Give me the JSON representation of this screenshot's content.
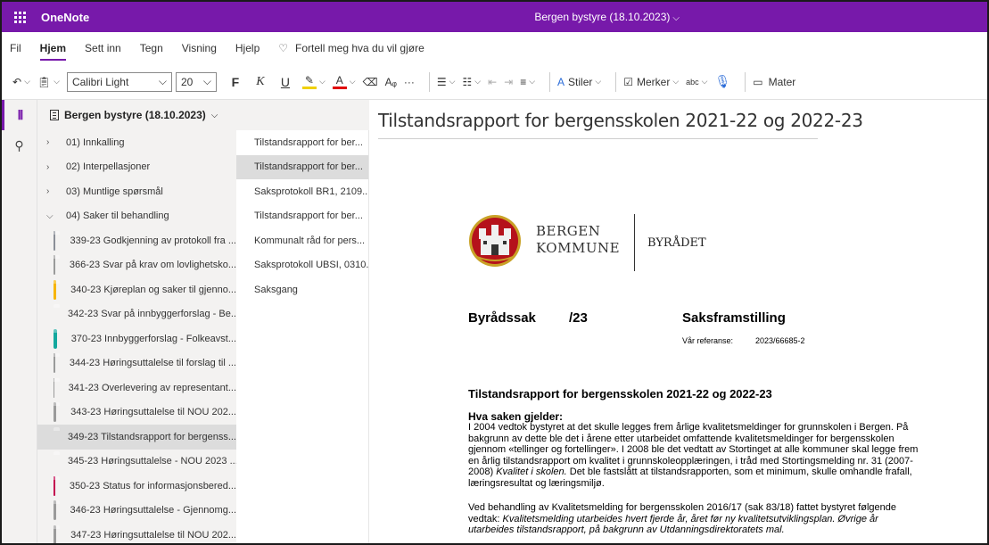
{
  "app": {
    "name": "OneNote",
    "doc_title": "Bergen bystyre (18.10.2023)"
  },
  "menu": {
    "items": [
      "Fil",
      "Hjem",
      "Sett inn",
      "Tegn",
      "Visning",
      "Hjelp"
    ],
    "active": "Hjem",
    "tell_me": "Fortell meg hva du vil gjøre"
  },
  "ribbon": {
    "font_name": "Calibri Light",
    "font_size": "20",
    "bold": "F",
    "italic": "K",
    "underline": "U",
    "color_letter": "A",
    "more": "···",
    "styles": "Stiler",
    "tags": "Merker",
    "spelling": "abc",
    "immersive": "Mater",
    "highlight_color": "#f0d000",
    "font_color": "#e00000"
  },
  "notebook": {
    "name": "Bergen bystyre (18.10.2023)"
  },
  "sections": [
    {
      "type": "group",
      "label": "01) Innkalling",
      "expanded": false
    },
    {
      "type": "group",
      "label": "02) Interpellasjoner",
      "expanded": false
    },
    {
      "type": "group",
      "label": "03) Muntlige spørsmål",
      "expanded": false
    },
    {
      "type": "group",
      "label": "04) Saker til behandling",
      "expanded": true
    },
    {
      "type": "child",
      "label": "339-23 Godkjenning av protokoll fra ...",
      "color": "#8a8f98"
    },
    {
      "type": "child",
      "label": "366-23 Svar på krav om lovlighetsko...",
      "color": "#9a9a9a"
    },
    {
      "type": "child",
      "label": "340-23 Kjøreplan og saker til gjenno...",
      "color": "#f7b500"
    },
    {
      "type": "child",
      "label": "342-23 Svar på innbyggerforslag - Be...",
      "color": "#f7b500"
    },
    {
      "type": "child",
      "label": "370-23 Innbyggerforslag - Folkeavst...",
      "color": "#13a89e"
    },
    {
      "type": "child",
      "label": "344-23 Høringsuttalelse til forslag til ...",
      "color": "#9a9a9a"
    },
    {
      "type": "child",
      "label": "341-23 Overlevering av representant...",
      "color": "#9a9a9a"
    },
    {
      "type": "child",
      "label": "343-23 Høringsuttalelse til NOU 202...",
      "color": "#9a9a9a"
    },
    {
      "type": "child",
      "label": "349-23 Tilstandsrapport for bergenss...",
      "color": "#1f5fa8",
      "selected": true
    },
    {
      "type": "child",
      "label": "345-23 Høringsuttalelse - NOU 2023 ...",
      "color": "#9a9a9a"
    },
    {
      "type": "child",
      "label": "350-23 Status for informasjonsbered...",
      "color": "#c3004e"
    },
    {
      "type": "child",
      "label": "346-23 Høringsuttalelse - Gjennomg...",
      "color": "#9a9a9a"
    },
    {
      "type": "child",
      "label": "347-23 Høringsuttalelse til NOU 202...",
      "color": "#9a9a9a"
    }
  ],
  "pages": [
    {
      "label": "Tilstandsrapport for ber...",
      "selected": false
    },
    {
      "label": "Tilstandsrapport for ber...",
      "selected": true
    },
    {
      "label": "Saksprotokoll BR1, 2109...",
      "selected": false
    },
    {
      "label": "Tilstandsrapport for ber...",
      "selected": false
    },
    {
      "label": "Kommunalt råd for pers...",
      "selected": false
    },
    {
      "label": "Saksprotokoll UBSI, 0310...",
      "selected": false
    },
    {
      "label": "Saksgang",
      "selected": false
    }
  ],
  "page": {
    "title": "Tilstandsrapport for bergensskolen 2021-22 og 2022-23"
  },
  "document": {
    "brand_line1": "BERGEN",
    "brand_line2": "KOMMUNE",
    "department": "BYRÅDET",
    "sak_label": "Byrådssak",
    "sak_number": "/23",
    "sak_type": "Saksframstilling",
    "ref_label": "Vår referanse:",
    "ref_value": "2023/66685-2",
    "heading": "Tilstandsrapport for bergensskolen 2021-22 og 2022-23",
    "para_head": "Hva saken gjelder:",
    "p1_a": "I 2004 vedtok bystyret at det skulle legges frem årlige kvalitetsmeldinger for grunnskolen i Bergen. På bakgrunn av dette ble det i årene etter utarbeidet omfattende kvalitetsmeldinger for bergensskolen gjennom «tellinger og fortellinger». I 2008 ble det vedtatt av Stortinget at alle kommuner skal legge frem en årlig tilstandsrapport om kvalitet i grunnskoleopplæringen, i tråd med Stortingsmelding nr. 31 (2007-2008) ",
    "p1_em": "Kvalitet i skolen.",
    "p1_b": " Det ble fastslått at tilstandsrapporten, som et minimum, skulle omhandle frafall, læringsresultat og læringsmiljø.",
    "p2_a": "Ved behandling av Kvalitetsmelding for bergensskolen 2016/17 (sak 83/18) fattet bystyret følgende vedtak: ",
    "p2_em": "Kvalitetsmelding utarbeides hvert fjerde år, året før ny kvalitetsutviklingsplan. Øvrige år utarbeides tilstandsrapport, på bakgrunn av Utdanningsdirektoratets mal."
  }
}
